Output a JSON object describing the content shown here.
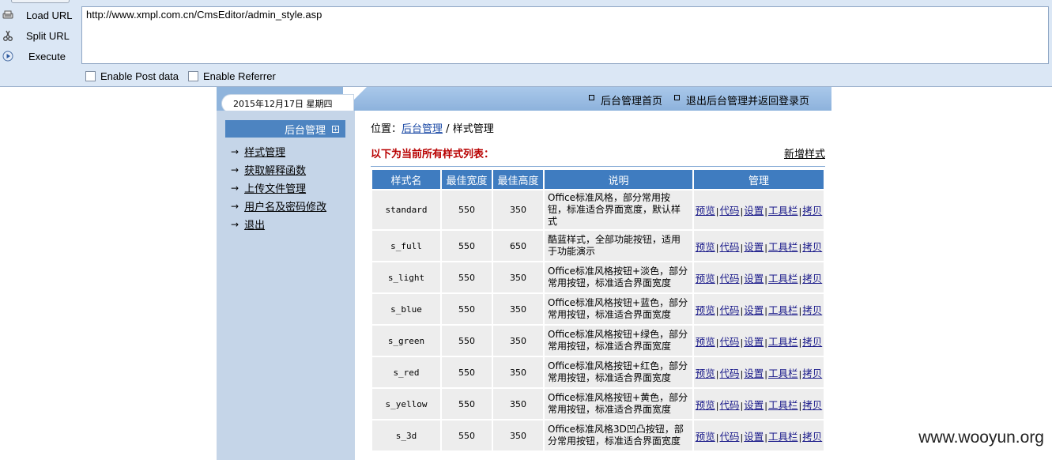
{
  "hackbar": {
    "load_url": "Load URL",
    "split_url": "Split URL",
    "execute": "Execute",
    "url": "http://www.xmpl.com.cn/CmsEditor/admin_style.asp",
    "enable_post": "Enable Post data",
    "enable_referrer": "Enable Referrer"
  },
  "header": {
    "date": "2015年12月17日 星期四",
    "link_home": "后台管理首页",
    "link_exit": "退出后台管理并返回登录页"
  },
  "sidebar": {
    "title": "后台管理",
    "items": [
      {
        "label": "样式管理"
      },
      {
        "label": "获取解释函数"
      },
      {
        "label": "上传文件管理"
      },
      {
        "label": "用户名及密码修改"
      },
      {
        "label": "退出"
      }
    ]
  },
  "main": {
    "crumb_prefix": "位置：",
    "crumb_link": "后台管理",
    "crumb_sep": "/",
    "crumb_current": "样式管理",
    "list_title": "以下为当前所有样式列表：",
    "add_style": "新增样式",
    "columns": [
      "样式名",
      "最佳宽度",
      "最佳高度",
      "说明",
      "管理"
    ],
    "ops": [
      "预览",
      "代码",
      "设置",
      "工具栏",
      "拷贝"
    ],
    "rows": [
      {
        "name": "standard",
        "width": "550",
        "height": "350",
        "desc": "Office标准风格，部分常用按钮，标准适合界面宽度，默认样式"
      },
      {
        "name": "s_full",
        "width": "550",
        "height": "650",
        "desc": "酷蓝样式，全部功能按钮，适用于功能演示"
      },
      {
        "name": "s_light",
        "width": "550",
        "height": "350",
        "desc": "Office标准风格按钮+淡色，部分常用按钮，标准适合界面宽度"
      },
      {
        "name": "s_blue",
        "width": "550",
        "height": "350",
        "desc": "Office标准风格按钮+蓝色，部分常用按钮，标准适合界面宽度"
      },
      {
        "name": "s_green",
        "width": "550",
        "height": "350",
        "desc": "Office标准风格按钮+绿色，部分常用按钮，标准适合界面宽度"
      },
      {
        "name": "s_red",
        "width": "550",
        "height": "350",
        "desc": "Office标准风格按钮+红色，部分常用按钮，标准适合界面宽度"
      },
      {
        "name": "s_yellow",
        "width": "550",
        "height": "350",
        "desc": "Office标准风格按钮+黄色，部分常用按钮，标准适合界面宽度"
      },
      {
        "name": "s_3d",
        "width": "550",
        "height": "350",
        "desc": "Office标准风格3D凹凸按钮，部分常用按钮，标准适合界面宽度"
      }
    ]
  },
  "watermark": "www.wooyun.org",
  "colors": {
    "hackbar_bg": "#dbe7f5",
    "header_blue": "#3f7cc0",
    "sidebar_bg": "#c5d5e8",
    "title_red": "#b80000"
  }
}
